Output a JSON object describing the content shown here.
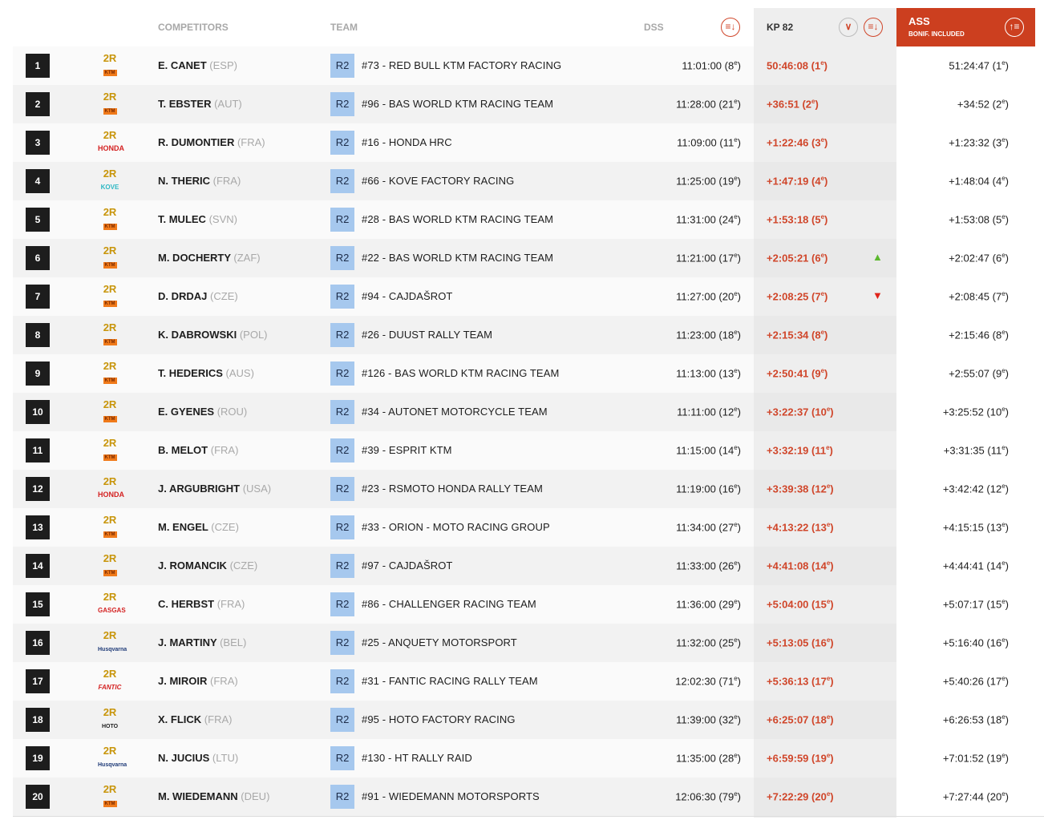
{
  "header": {
    "competitors": "COMPETITORS",
    "team": "TEAM",
    "dss": "DSS",
    "kp": "KP 82",
    "ass": "ASS",
    "ass_sub": "BONIF. INCLUDED"
  },
  "colors": {
    "accent": "#cc3f1f",
    "up": "#5cb82e",
    "down": "#e0241a"
  },
  "rows": [
    {
      "rank": "1",
      "brand": "KTM",
      "brand_class": "ktm",
      "name": "E. CANET",
      "nat": "(ESP)",
      "cat": "R2",
      "team": "#73 - RED BULL KTM FACTORY RACING",
      "dss": "11:01:00 (8",
      "dss_pos": "e",
      "kp": "50:46:08 (1",
      "ass": "51:24:47 (1",
      "arrow": ""
    },
    {
      "rank": "2",
      "brand": "KTM",
      "brand_class": "ktm",
      "name": "T. EBSTER",
      "nat": "(AUT)",
      "cat": "R2",
      "team": "#96 - BAS WORLD KTM RACING TEAM",
      "dss": "11:28:00 (21",
      "kp": "+36:51 (2",
      "ass": "+34:52 (2",
      "arrow": ""
    },
    {
      "rank": "3",
      "brand": "HONDA",
      "brand_class": "honda",
      "name": "R. DUMONTIER",
      "nat": "(FRA)",
      "cat": "R2",
      "team": "#16 - HONDA HRC",
      "dss": "11:09:00 (11",
      "kp": "+1:22:46 (3",
      "ass": "+1:23:32 (3",
      "arrow": ""
    },
    {
      "rank": "4",
      "brand": "KOVE",
      "brand_class": "kove",
      "name": "N. THERIC",
      "nat": "(FRA)",
      "cat": "R2",
      "team": "#66 - KOVE FACTORY RACING",
      "dss": "11:25:00 (19",
      "kp": "+1:47:19 (4",
      "ass": "+1:48:04 (4",
      "arrow": ""
    },
    {
      "rank": "5",
      "brand": "KTM",
      "brand_class": "ktm",
      "name": "T. MULEC",
      "nat": "(SVN)",
      "cat": "R2",
      "team": "#28 - BAS WORLD KTM RACING TEAM",
      "dss": "11:31:00 (24",
      "kp": "+1:53:18 (5",
      "ass": "+1:53:08 (5",
      "arrow": ""
    },
    {
      "rank": "6",
      "brand": "KTM",
      "brand_class": "ktm",
      "name": "M. DOCHERTY",
      "nat": "(ZAF)",
      "cat": "R2",
      "team": "#22 - BAS WORLD KTM RACING TEAM",
      "dss": "11:21:00 (17",
      "kp": "+2:05:21 (6",
      "ass": "+2:02:47 (6",
      "arrow": "up"
    },
    {
      "rank": "7",
      "brand": "KTM",
      "brand_class": "ktm",
      "name": "D. DRDAJ",
      "nat": "(CZE)",
      "cat": "R2",
      "team": "#94 - CAJDAŠROT",
      "dss": "11:27:00 (20",
      "kp": "+2:08:25 (7",
      "ass": "+2:08:45 (7",
      "arrow": "down"
    },
    {
      "rank": "8",
      "brand": "KTM",
      "brand_class": "ktm",
      "name": "K. DABROWSKI",
      "nat": "(POL)",
      "cat": "R2",
      "team": "#26 - DUUST RALLY TEAM",
      "dss": "11:23:00 (18",
      "kp": "+2:15:34 (8",
      "ass": "+2:15:46 (8",
      "arrow": ""
    },
    {
      "rank": "9",
      "brand": "KTM",
      "brand_class": "ktm",
      "name": "T. HEDERICS",
      "nat": "(AUS)",
      "cat": "R2",
      "team": "#126 - BAS WORLD KTM RACING TEAM",
      "dss": "11:13:00 (13",
      "kp": "+2:50:41 (9",
      "ass": "+2:55:07 (9",
      "arrow": ""
    },
    {
      "rank": "10",
      "brand": "KTM",
      "brand_class": "ktm",
      "name": "E. GYENES",
      "nat": "(ROU)",
      "cat": "R2",
      "team": "#34 - AUTONET MOTORCYCLE TEAM",
      "dss": "11:11:00 (12",
      "kp": "+3:22:37 (10",
      "ass": "+3:25:52 (10",
      "arrow": ""
    },
    {
      "rank": "11",
      "brand": "KTM",
      "brand_class": "ktm",
      "name": "B. MELOT",
      "nat": "(FRA)",
      "cat": "R2",
      "team": "#39 - ESPRIT KTM",
      "dss": "11:15:00 (14",
      "kp": "+3:32:19 (11",
      "ass": "+3:31:35 (11",
      "arrow": ""
    },
    {
      "rank": "12",
      "brand": "HONDA",
      "brand_class": "honda",
      "name": "J. ARGUBRIGHT",
      "nat": "(USA)",
      "cat": "R2",
      "team": "#23 - RSMOTO HONDA RALLY TEAM",
      "dss": "11:19:00 (16",
      "kp": "+3:39:38 (12",
      "ass": "+3:42:42 (12",
      "arrow": ""
    },
    {
      "rank": "13",
      "brand": "KTM",
      "brand_class": "ktm",
      "name": "M. ENGEL",
      "nat": "(CZE)",
      "cat": "R2",
      "team": "#33 - ORION - MOTO RACING GROUP",
      "dss": "11:34:00 (27",
      "kp": "+4:13:22 (13",
      "ass": "+4:15:15 (13",
      "arrow": ""
    },
    {
      "rank": "14",
      "brand": "KTM",
      "brand_class": "ktm",
      "name": "J. ROMANCIK",
      "nat": "(CZE)",
      "cat": "R2",
      "team": "#97 - CAJDAŠROT",
      "dss": "11:33:00 (26",
      "kp": "+4:41:08 (14",
      "ass": "+4:44:41 (14",
      "arrow": ""
    },
    {
      "rank": "15",
      "brand": "GASGAS",
      "brand_class": "gasgas",
      "name": "C. HERBST",
      "nat": "(FRA)",
      "cat": "R2",
      "team": "#86 - CHALLENGER RACING TEAM",
      "dss": "11:36:00 (29",
      "kp": "+5:04:00 (15",
      "ass": "+5:07:17 (15",
      "arrow": ""
    },
    {
      "rank": "16",
      "brand": "Husqvarna",
      "brand_class": "husq",
      "name": "J. MARTINY",
      "nat": "(BEL)",
      "cat": "R2",
      "team": "#25 - ANQUETY MOTORSPORT",
      "dss": "11:32:00 (25",
      "kp": "+5:13:05 (16",
      "ass": "+5:16:40 (16",
      "arrow": ""
    },
    {
      "rank": "17",
      "brand": "FANTIC",
      "brand_class": "fantic",
      "name": "J. MIROIR",
      "nat": "(FRA)",
      "cat": "R2",
      "team": "#31 - FANTIC RACING RALLY TEAM",
      "dss": "12:02:30 (71",
      "kp": "+5:36:13 (17",
      "ass": "+5:40:26 (17",
      "arrow": ""
    },
    {
      "rank": "18",
      "brand": "HOTO",
      "brand_class": "hoto",
      "name": "X. FLICK",
      "nat": "(FRA)",
      "cat": "R2",
      "team": "#95 - HOTO FACTORY RACING",
      "dss": "11:39:00 (32",
      "kp": "+6:25:07 (18",
      "ass": "+6:26:53 (18",
      "arrow": ""
    },
    {
      "rank": "19",
      "brand": "Husqvarna",
      "brand_class": "husq",
      "name": "N. JUCIUS",
      "nat": "(LTU)",
      "cat": "R2",
      "team": "#130 - HT RALLY RAID",
      "dss": "11:35:00 (28",
      "kp": "+6:59:59 (19",
      "ass": "+7:01:52 (19",
      "arrow": ""
    },
    {
      "rank": "20",
      "brand": "KTM",
      "brand_class": "ktm",
      "name": "M. WIEDEMANN",
      "nat": "(DEU)",
      "cat": "R2",
      "team": "#91 - WIEDEMANN MOTORSPORTS",
      "dss": "12:06:30 (79",
      "kp": "+7:22:29 (20",
      "ass": "+7:27:44 (20",
      "arrow": ""
    }
  ]
}
